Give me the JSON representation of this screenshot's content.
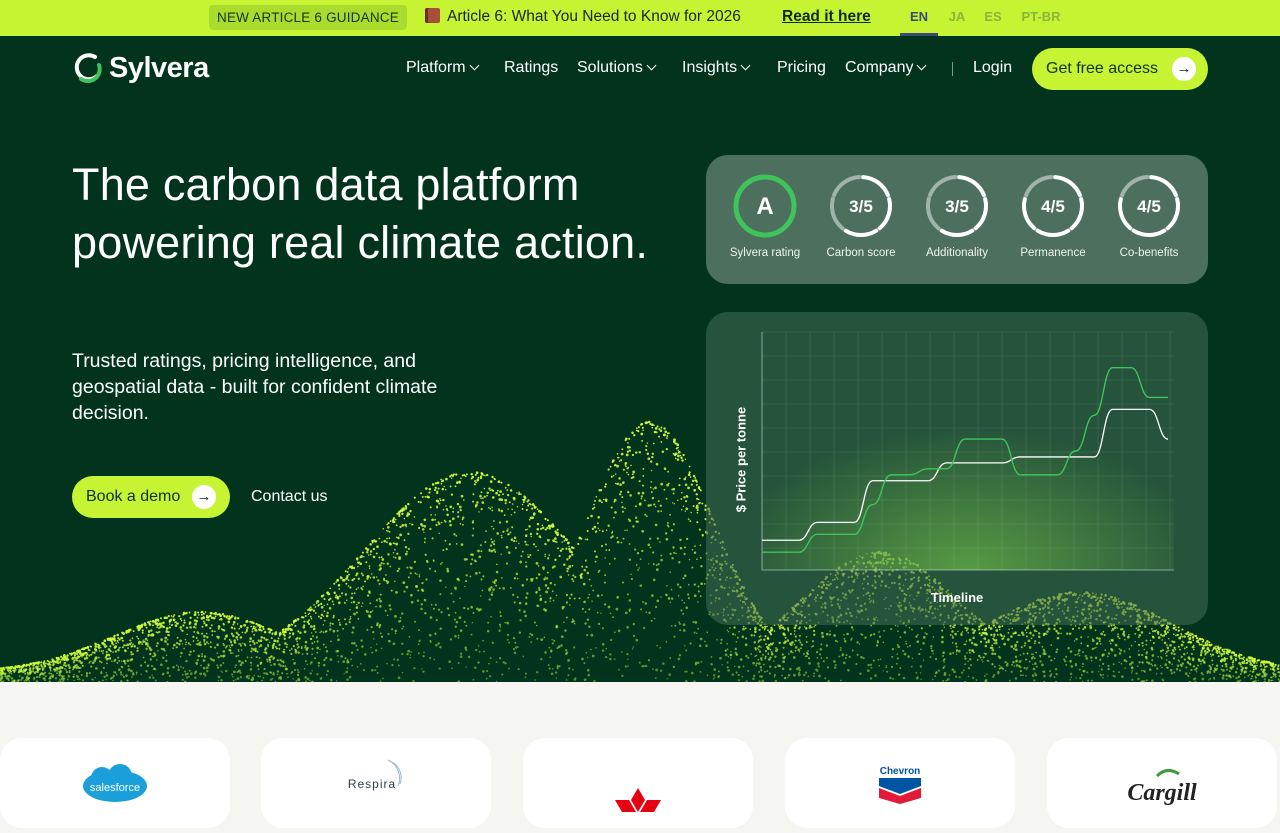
{
  "announcement": {
    "badge": "NEW ARTICLE 6 GUIDANCE",
    "message": "Article 6: What You Need to Know for 2026",
    "link": "Read it here",
    "languages": [
      "EN",
      "JA",
      "ES",
      "PT-BR"
    ],
    "active_language": "EN"
  },
  "header": {
    "logo_text": "Sylvera",
    "nav": [
      "Platform",
      "Ratings",
      "Solutions",
      "Insights",
      "Pricing",
      "Company"
    ],
    "login": "Login",
    "cta": "Get free access"
  },
  "hero": {
    "headline": "The carbon data platform powering real climate action.",
    "subheadline": "Trusted ratings, pricing intelligence, and geospatial data - built for confident climate decision.",
    "primary_button": "Book a demo",
    "secondary_link": "Contact us"
  },
  "ratings_card": {
    "items": [
      {
        "value": "A",
        "label": "Sylvera rating",
        "fraction": 1.0
      },
      {
        "value": "3/5",
        "label": "Carbon score",
        "fraction": 0.6
      },
      {
        "value": "3/5",
        "label": "Additionality",
        "fraction": 0.6
      },
      {
        "value": "4/5",
        "label": "Permanence",
        "fraction": 0.8
      },
      {
        "value": "4/5",
        "label": "Co-benefits",
        "fraction": 0.8
      }
    ],
    "accent": "#3ec45a"
  },
  "chart_data": {
    "type": "line",
    "ylabel": "$ Price per tonne",
    "xlabel": "Timeline",
    "series": [
      {
        "values": [
          5,
          5,
          5,
          8,
          8,
          8,
          15,
          15,
          15,
          15,
          18,
          18,
          18,
          18,
          19,
          19,
          19,
          19,
          19,
          27,
          27,
          27,
          22
        ]
      },
      {
        "values": [
          3,
          3,
          3,
          6,
          6,
          6,
          11,
          16,
          16,
          17,
          17,
          22,
          22,
          22,
          16,
          16,
          16,
          20,
          26,
          34,
          34,
          29,
          29
        ]
      }
    ],
    "ylim": [
      0,
      40
    ],
    "colors": {
      "series1": "#ffffff",
      "series2": "#3ec45a"
    }
  },
  "logos": [
    "salesforce",
    "Respira",
    "Mitsubishi",
    "Chevron",
    "Cargill"
  ],
  "colors": {
    "brand_lime": "#c6f432",
    "hero_bg": "#01331d"
  }
}
